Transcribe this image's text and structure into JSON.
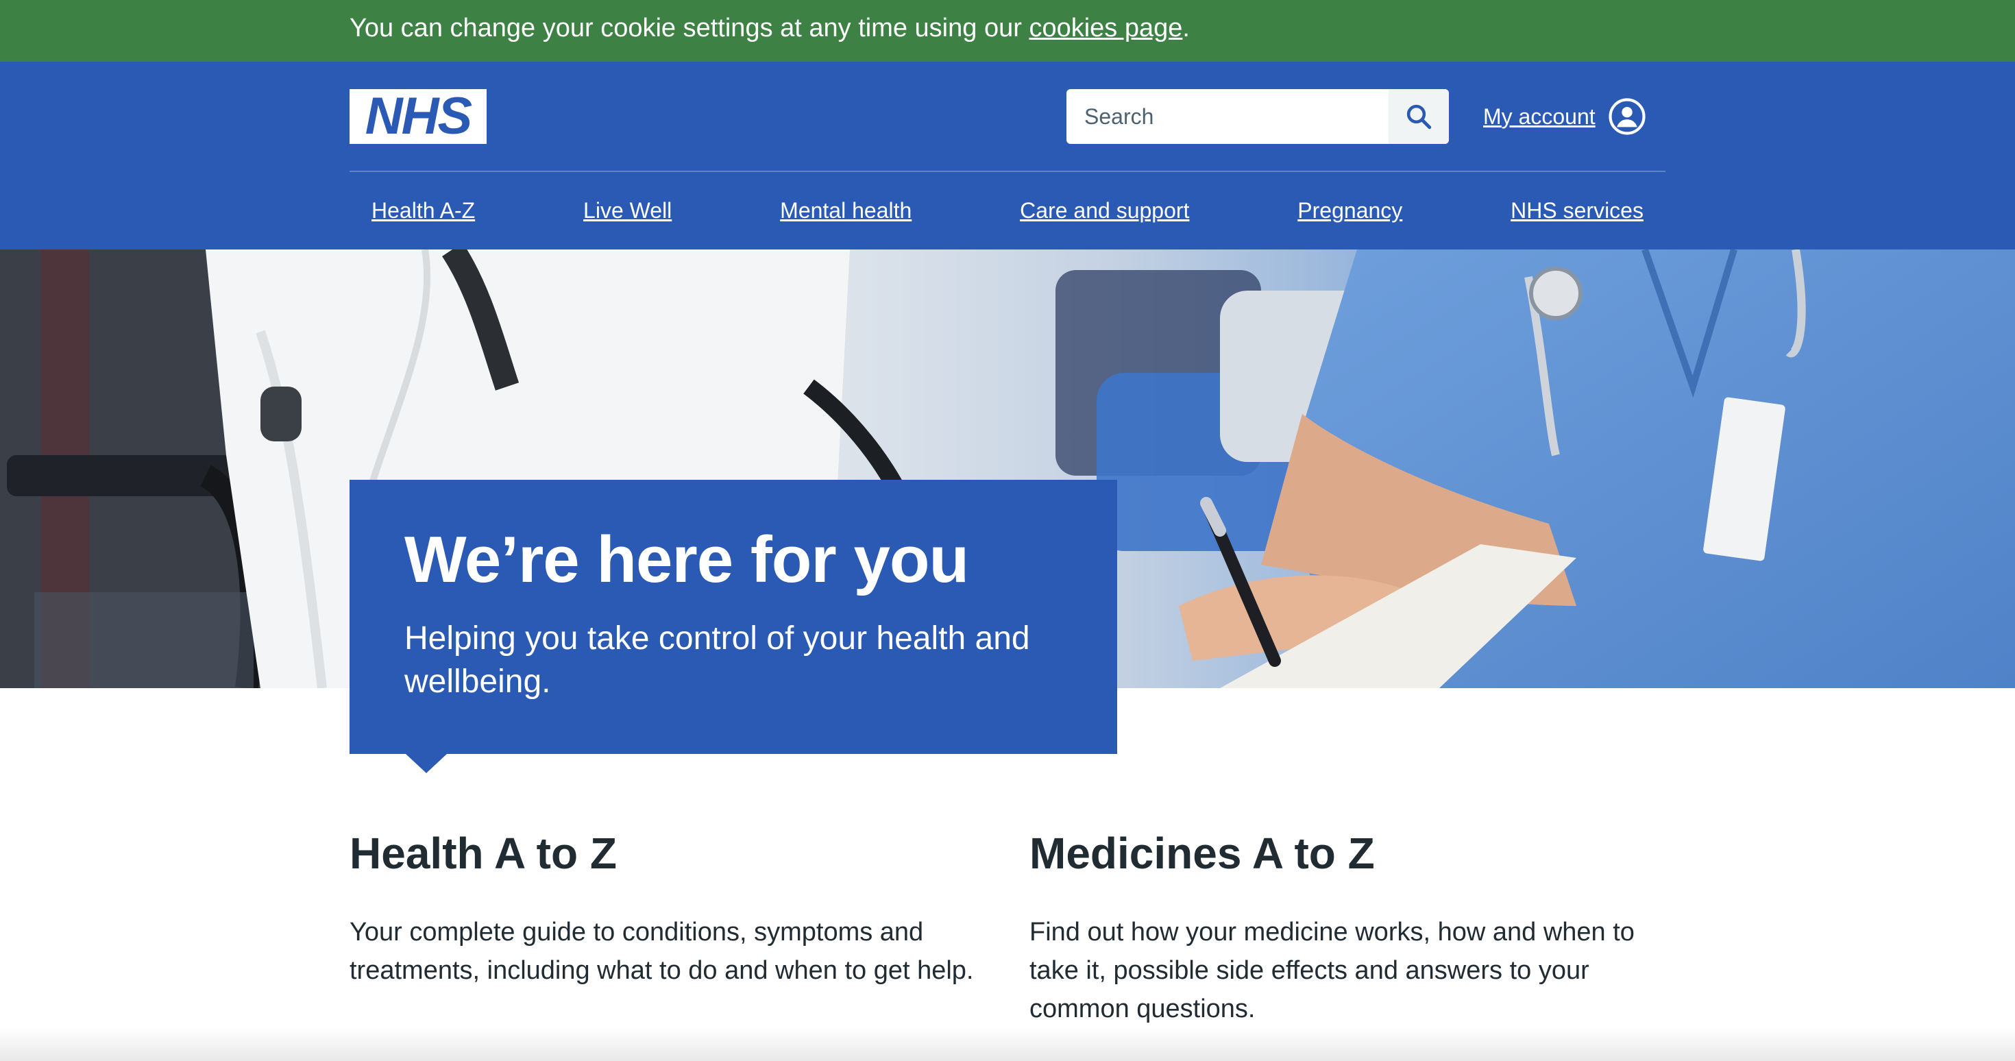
{
  "cookie_banner": {
    "text": "You can change your cookie settings at any time using our ",
    "link": "cookies page",
    "suffix": "."
  },
  "header": {
    "logo_text": "NHS",
    "search": {
      "placeholder": "Search"
    },
    "account_label": "My account"
  },
  "nav": {
    "items": [
      {
        "label": "Health A-Z"
      },
      {
        "label": "Live Well"
      },
      {
        "label": "Mental health"
      },
      {
        "label": "Care and support"
      },
      {
        "label": "Pregnancy"
      },
      {
        "label": "NHS services"
      }
    ]
  },
  "hero": {
    "title": "We’re here for you",
    "subtitle": "Helping you take control of your health and wellbeing."
  },
  "sections": [
    {
      "title": "Health A to Z",
      "body": "Your complete guide to conditions, symptoms and treatments, including what to do and when to get help."
    },
    {
      "title": "Medicines A to Z",
      "body": "Find out how your medicine works, how and when to take it, possible side effects and answers to your common questions."
    }
  ],
  "icons": {
    "search": "search-icon",
    "account": "user-circle-icon"
  },
  "colors": {
    "nhs_blue": "#2a5ab4",
    "cookie_green": "#3d8244",
    "text": "#212b32"
  }
}
